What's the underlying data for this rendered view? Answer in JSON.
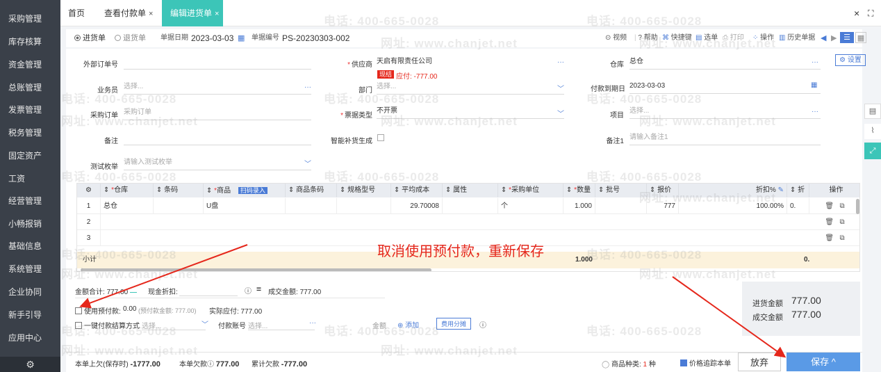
{
  "sidebar": {
    "items": [
      {
        "label": "采购管理"
      },
      {
        "label": "库存核算"
      },
      {
        "label": "资金管理"
      },
      {
        "label": "总账管理"
      },
      {
        "label": "发票管理"
      },
      {
        "label": "税务管理"
      },
      {
        "label": "固定资产"
      },
      {
        "label": "工资"
      },
      {
        "label": "经营管理"
      },
      {
        "label": "小畅报销"
      },
      {
        "label": "基础信息"
      },
      {
        "label": "系统管理"
      },
      {
        "label": "企业协同"
      },
      {
        "label": "新手引导"
      },
      {
        "label": "应用中心"
      }
    ],
    "settings_icon": "⚙"
  },
  "tabs": {
    "home": "首页",
    "view_payment": "查看付款单",
    "edit_purchase": "编辑进货单",
    "close": "×",
    "window_close": "×",
    "fullscreen": "⛶"
  },
  "toolbar": {
    "purchase": "进货单",
    "return": "退货单",
    "date_label": "单据日期",
    "date_value": "2023-03-03",
    "number_label": "单据编号",
    "number_value": "PS-20230303-002",
    "video": "视频",
    "help": "帮助",
    "shortcut": "快捷键",
    "select": "选单",
    "print": "打印",
    "operate": "操作",
    "history": "历史单据"
  },
  "form": {
    "ext_order_label": "外部订单号",
    "supplier_label": "供应商",
    "supplier_value": "天启有限责任公司",
    "supplier_badge": "现结",
    "supplier_due": "应付: -777.00",
    "warehouse_label": "仓库",
    "warehouse_value": "总仓",
    "settings_button": "设置",
    "salesman_label": "业务员",
    "salesman_ph": "选择...",
    "dept_label": "部门",
    "dept_ph": "选择...",
    "pay_due_label": "付款到期日",
    "pay_due_value": "2023-03-03",
    "po_label": "采购订单",
    "po_ph": "采购订单",
    "invoice_type_label": "票据类型",
    "invoice_type_value": "不开票",
    "project_label": "项目",
    "project_ph": "选择...",
    "remark_label": "备注",
    "smart_fill_label": "智能补货生成",
    "remark1_label": "备注1",
    "remark1_ph": "请输入备注1",
    "test_label": "测试枚举",
    "test_ph": "请输入测试枚举"
  },
  "grid": {
    "headers": {
      "warehouse": "仓库",
      "barcode": "条码",
      "product": "商品",
      "scan": "扫码录入",
      "product_barcode": "商品条码",
      "spec": "规格型号",
      "avg_cost": "平均成本",
      "attr": "属性",
      "unit": "采购单位",
      "qty": "数量",
      "batch": "批号",
      "price": "报价",
      "discount": "折扣%",
      "disc2": "折",
      "action": "操作"
    },
    "rows": [
      {
        "no": "1",
        "warehouse": "总仓",
        "product": "U盘",
        "avg_cost": "29.70008",
        "unit": "个",
        "qty": "1.000",
        "price": "777",
        "discount": "100.00%",
        "disc2": "0."
      },
      {
        "no": "2"
      },
      {
        "no": "3"
      }
    ],
    "subtotal_label": "小计",
    "subtotal_qty": "1.000",
    "subtotal_disc2": "0."
  },
  "bottom": {
    "total_label": "金额合计:",
    "total_value": "777.00",
    "cash_discount_label": "现金折扣:",
    "deal_label": "成交金额:",
    "deal_value": "777.00",
    "use_prepay_label": "使用预付款:",
    "use_prepay_value": "0.00",
    "prepay_balance": "(预付款金额: 777.00)",
    "actual_pay": "实际应付: 777.00",
    "one_click_label": "一键付款",
    "settle_label": "结算方式",
    "settle_ph": "选择...",
    "pay_account_label": "付款账号",
    "pay_account_ph": "选择...",
    "amount_label": "金额",
    "add_label": "添加",
    "fee_split": "费用分摊"
  },
  "summary": {
    "purchase_amount_label": "进货金额",
    "purchase_amount_value": "777.00",
    "deal_amount_label": "成交金额",
    "deal_amount_value": "777.00"
  },
  "footer": {
    "last_owe_label": "本单上欠(保存时)",
    "last_owe_value": "-1777.00",
    "this_owe_label": "本单欠款",
    "this_owe_value": "777.00",
    "total_owe_label": "累计欠款",
    "total_owe_value": "-777.00",
    "kinds_label": "商品种类:",
    "kinds_value": "1",
    "kinds_unit": "种",
    "track_price": "价格追踪本单",
    "abandon": "放弃",
    "save": "保存 ^"
  },
  "annotation": {
    "text": "取消使用预付款，重新保存"
  },
  "watermark": {
    "phone": "电话: 400-665-0028",
    "site": "网址: www.chanjet.net"
  },
  "colors": {
    "sidebar_bg": "#3a4049",
    "tab_active": "#3cc5b8",
    "primary": "#4a7bd6",
    "annotation_red": "#e5271b",
    "subtotal_bg": "#fcf2dc"
  }
}
